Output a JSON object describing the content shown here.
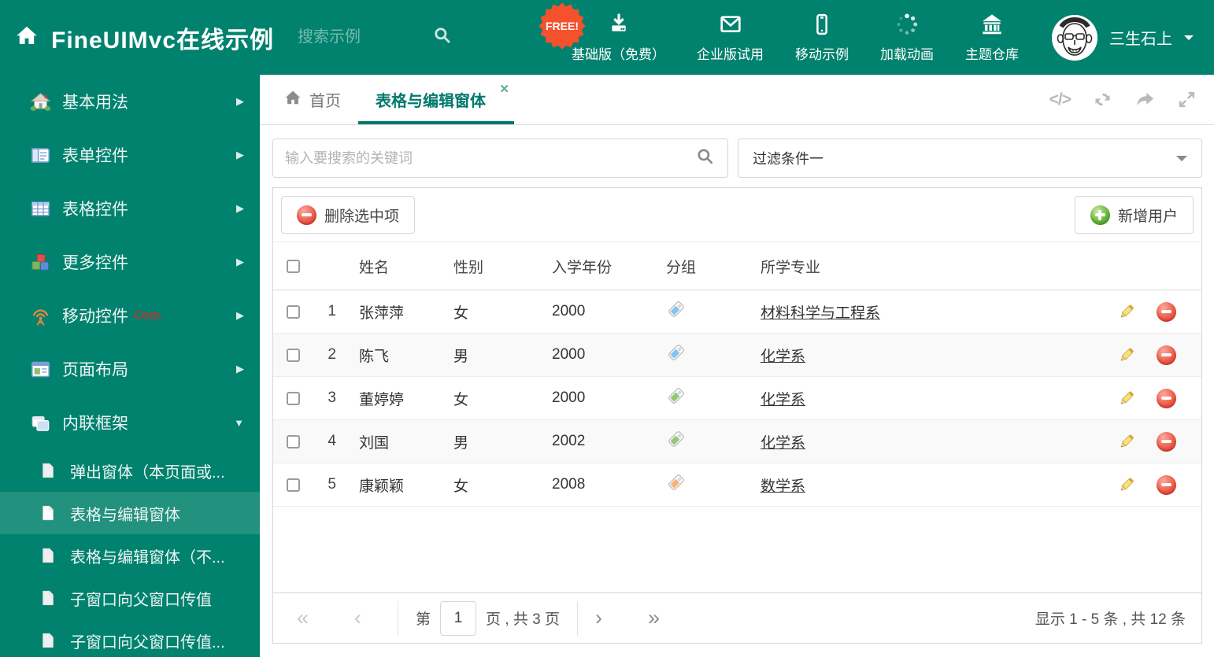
{
  "header": {
    "logo_title": "FineUIMvc在线示例",
    "search_placeholder": "搜索示例",
    "free_badge": "FREE!",
    "nav_items": [
      {
        "label": "基础版（免费）",
        "icon": "download-icon"
      },
      {
        "label": "企业版试用",
        "icon": "envelope-icon"
      },
      {
        "label": "移动示例",
        "icon": "mobile-icon"
      },
      {
        "label": "加载动画",
        "icon": "spinner-icon"
      },
      {
        "label": "主题仓库",
        "icon": "bank-icon"
      }
    ],
    "user_name": "三生石上"
  },
  "sidebar": {
    "items": [
      {
        "label": "基本用法",
        "icon": "home-icon"
      },
      {
        "label": "表单控件",
        "icon": "form-icon"
      },
      {
        "label": "表格控件",
        "icon": "table-icon"
      },
      {
        "label": "更多控件",
        "icon": "cubes-icon"
      },
      {
        "label": "移动控件",
        "badge": "Corp.",
        "icon": "antenna-icon"
      },
      {
        "label": "页面布局",
        "icon": "layout-icon"
      },
      {
        "label": "内联框架",
        "icon": "frames-icon"
      }
    ],
    "subitems": [
      {
        "label": "弹出窗体（本页面或..."
      },
      {
        "label": "表格与编辑窗体",
        "selected": true
      },
      {
        "label": "表格与编辑窗体（不..."
      },
      {
        "label": "子窗口向父窗口传值"
      },
      {
        "label": "子窗口向父窗口传值..."
      }
    ]
  },
  "tabs": [
    {
      "label": "首页"
    },
    {
      "label": "表格与编辑窗体",
      "active": true
    }
  ],
  "filters": {
    "keyword_placeholder": "输入要搜索的关键词",
    "filter_selected": "过滤条件一"
  },
  "toolbar": {
    "delete_label": "删除选中项",
    "add_label": "新增用户"
  },
  "table": {
    "headers": [
      "姓名",
      "性别",
      "入学年份",
      "分组",
      "所学专业"
    ],
    "rows": [
      {
        "num": "1",
        "name": "张萍萍",
        "gender": "女",
        "year": "2000",
        "tag_color": "#85c4f0",
        "major": "材料科学与工程系"
      },
      {
        "num": "2",
        "name": "陈飞",
        "gender": "男",
        "year": "2000",
        "tag_color": "#85c4f0",
        "major": "化学系"
      },
      {
        "num": "3",
        "name": "董婷婷",
        "gender": "女",
        "year": "2000",
        "tag_color": "#93c878",
        "major": "化学系"
      },
      {
        "num": "4",
        "name": "刘国",
        "gender": "男",
        "year": "2002",
        "tag_color": "#93c878",
        "major": "化学系"
      },
      {
        "num": "5",
        "name": "康颖颖",
        "gender": "女",
        "year": "2008",
        "tag_color": "#f8b273",
        "major": "数学系"
      }
    ]
  },
  "pagination": {
    "page_prefix": "第",
    "page_value": "1",
    "page_suffix": "页 , 共 3 页",
    "summary": "显示 1 - 5 条 , 共 12 条"
  },
  "icons": {
    "sidebar_arrow_collapsed": "▶",
    "sidebar_arrow_expanded": "▼",
    "tab_close": "✕",
    "code_tool": "</>",
    "pagination_first": "«",
    "pagination_prev": "‹",
    "pagination_next": "›",
    "pagination_last": "»"
  },
  "colors": {
    "accent_teal": "#00826E",
    "tab_active": "#00796B",
    "free_badge_bg": "#F4512C",
    "corp_badge": "#FF1A1A",
    "delete_icon_red": "#EF5C4A",
    "add_icon_green": "#67B73B",
    "tag_blue": "#85C4F0",
    "tag_green": "#93C878",
    "tag_orange": "#F8B273"
  }
}
